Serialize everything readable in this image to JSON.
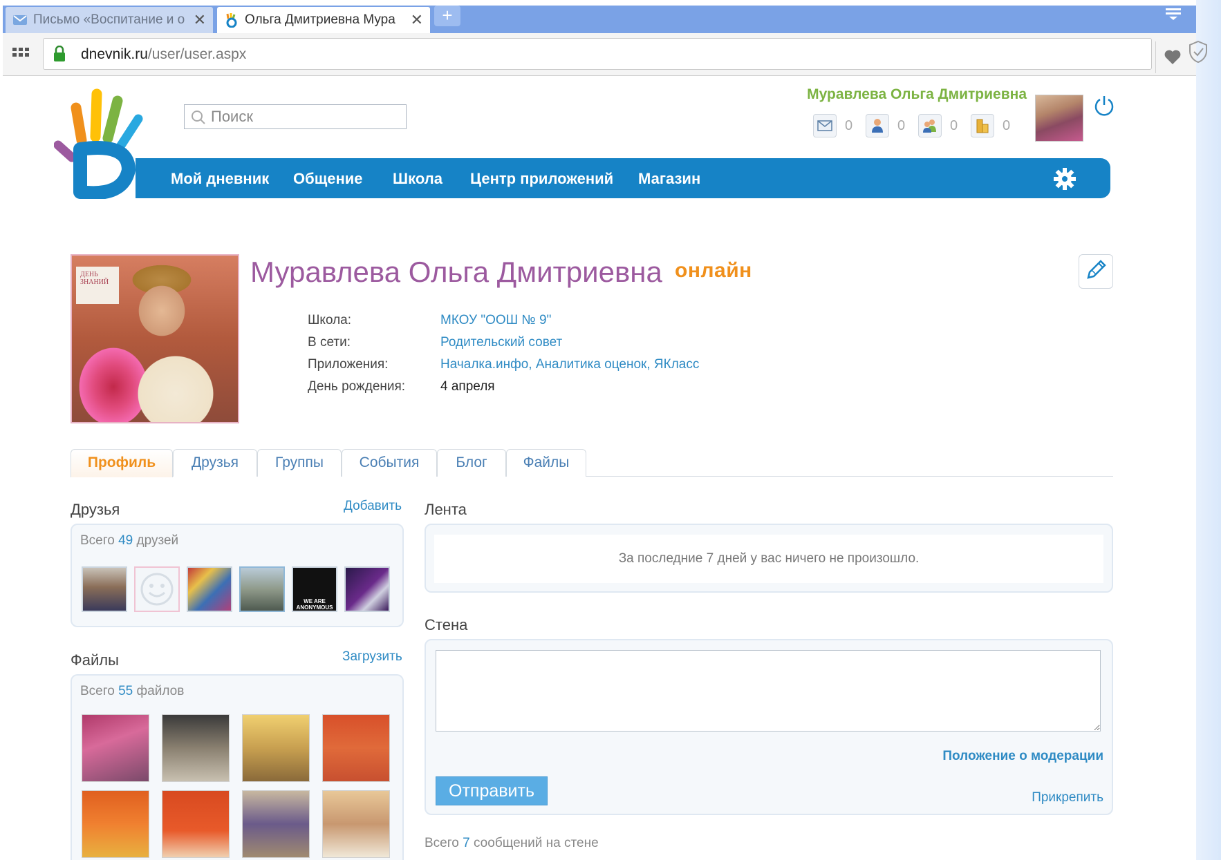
{
  "browser": {
    "tabs": [
      {
        "label": "Письмо «Воспитание и о",
        "close": "✕",
        "active": false
      },
      {
        "label": "Ольга Дмитриевна Мура",
        "close": "✕",
        "active": true
      }
    ],
    "new_tab": "+",
    "url_domain": "dnevnik.ru",
    "url_path": "/user/user.aspx"
  },
  "header": {
    "search_placeholder": "Поиск",
    "user_name": "Муравлева Ольга Дмитриевна",
    "counters": [
      {
        "icon": "envelope-icon",
        "value": "0"
      },
      {
        "icon": "person-icon",
        "value": "0"
      },
      {
        "icon": "people-icon",
        "value": "0"
      },
      {
        "icon": "coins-icon",
        "value": "0"
      }
    ]
  },
  "nav": {
    "items": [
      "Мой дневник",
      "Общение",
      "Школа",
      "Центр приложений",
      "Магазин"
    ]
  },
  "profile": {
    "name": "Муравлева Ольга Дмитриевна",
    "status": "онлайн",
    "photo_sign": "ДЕНЬ ЗНАНИЙ",
    "info": [
      {
        "label": "Школа:",
        "value": "МКОУ \"ООШ № 9\"",
        "link": true
      },
      {
        "label": "В сети:",
        "value": "Родительский совет",
        "link": true
      },
      {
        "label": "Приложения:",
        "value": "Началка.инфо, Аналитика оценок, ЯКласс",
        "link": true
      },
      {
        "label": "День рождения:",
        "value": "4 апреля",
        "link": false
      }
    ]
  },
  "tabs": [
    "Профиль",
    "Друзья",
    "Группы",
    "События",
    "Блог",
    "Файлы"
  ],
  "friends": {
    "title": "Друзья",
    "add_label": "Добавить",
    "total_prefix": "Всего",
    "total_count": "49",
    "total_suffix": "друзей",
    "thumb_text": "WE ARE ANONYMOUS"
  },
  "files": {
    "title": "Файлы",
    "upload_label": "Загрузить",
    "total_prefix": "Всего",
    "total_count": "55",
    "total_suffix": "файлов"
  },
  "feed": {
    "title": "Лента",
    "empty_text": "За последние 7 дней у вас ничего не произошло."
  },
  "wall": {
    "title": "Стена",
    "moderation_link": "Положение о модерации",
    "send_label": "Отправить",
    "attach_label": "Прикрепить",
    "count_prefix": "Всего",
    "count": "7",
    "count_suffix": "сообщений на стене"
  }
}
